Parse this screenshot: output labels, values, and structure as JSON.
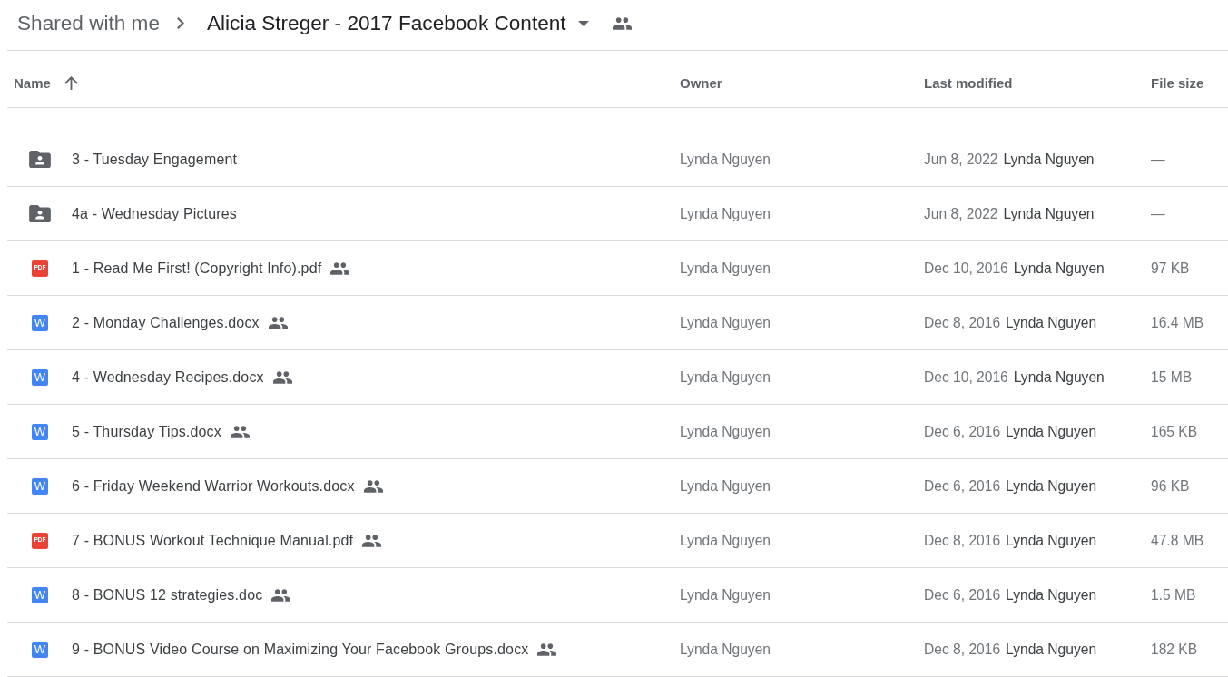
{
  "breadcrumb": {
    "parent": "Shared with me",
    "current": "Alicia Streger - 2017 Facebook Content",
    "shared": true
  },
  "table": {
    "columns": [
      {
        "label": "Name",
        "sort_ascending": true
      },
      {
        "label": "Owner"
      },
      {
        "label": "Last modified"
      },
      {
        "label": "File size"
      }
    ],
    "rows": [
      {
        "kind": "shared-folder",
        "name": "3 - Tuesday Engagement",
        "shared": false,
        "owner": "Lynda Nguyen",
        "modified_date": "Jun 8, 2022",
        "modified_by": "Lynda Nguyen",
        "file_size": "—"
      },
      {
        "kind": "shared-folder",
        "name": "4a - Wednesday Pictures",
        "shared": false,
        "owner": "Lynda Nguyen",
        "modified_date": "Jun 8, 2022",
        "modified_by": "Lynda Nguyen",
        "file_size": "—"
      },
      {
        "kind": "pdf",
        "icon_label": "PDF",
        "name": "1 - Read Me First! (Copyright Info).pdf",
        "shared": true,
        "owner": "Lynda Nguyen",
        "modified_date": "Dec 10, 2016",
        "modified_by": "Lynda Nguyen",
        "file_size": "97 KB"
      },
      {
        "kind": "word",
        "icon_label": "W",
        "name": "2 - Monday Challenges.docx",
        "shared": true,
        "owner": "Lynda Nguyen",
        "modified_date": "Dec 8, 2016",
        "modified_by": "Lynda Nguyen",
        "file_size": "16.4 MB"
      },
      {
        "kind": "word",
        "icon_label": "W",
        "name": "4 - Wednesday Recipes.docx",
        "shared": true,
        "owner": "Lynda Nguyen",
        "modified_date": "Dec 10, 2016",
        "modified_by": "Lynda Nguyen",
        "file_size": "15 MB"
      },
      {
        "kind": "word",
        "icon_label": "W",
        "name": "5 - Thursday Tips.docx",
        "shared": true,
        "owner": "Lynda Nguyen",
        "modified_date": "Dec 6, 2016",
        "modified_by": "Lynda Nguyen",
        "file_size": "165 KB"
      },
      {
        "kind": "word",
        "icon_label": "W",
        "name": "6 - Friday Weekend Warrior Workouts.docx",
        "shared": true,
        "owner": "Lynda Nguyen",
        "modified_date": "Dec 6, 2016",
        "modified_by": "Lynda Nguyen",
        "file_size": "96 KB"
      },
      {
        "kind": "pdf",
        "icon_label": "PDF",
        "name": "7 - BONUS Workout Technique Manual.pdf",
        "shared": true,
        "owner": "Lynda Nguyen",
        "modified_date": "Dec 8, 2016",
        "modified_by": "Lynda Nguyen",
        "file_size": "47.8 MB"
      },
      {
        "kind": "word",
        "icon_label": "W",
        "name": "8 - BONUS 12 strategies.doc",
        "shared": true,
        "owner": "Lynda Nguyen",
        "modified_date": "Dec 6, 2016",
        "modified_by": "Lynda Nguyen",
        "file_size": "1.5 MB"
      },
      {
        "kind": "word",
        "icon_label": "W",
        "name": "9 - BONUS Video Course on Maximizing Your Facebook Groups.docx",
        "shared": true,
        "owner": "Lynda Nguyen",
        "modified_date": "Dec 8, 2016",
        "modified_by": "Lynda Nguyen",
        "file_size": "182 KB"
      }
    ]
  }
}
